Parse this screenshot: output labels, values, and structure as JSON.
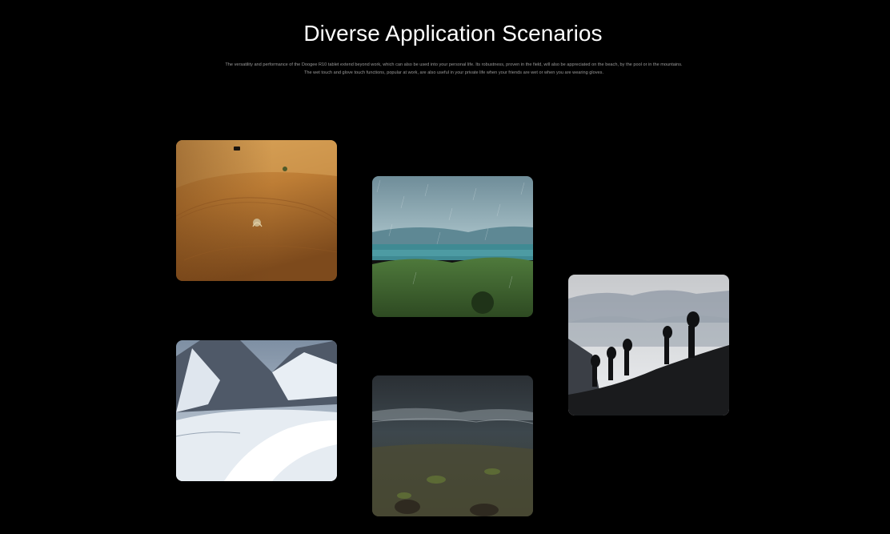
{
  "section": {
    "title": "Diverse Application Scenarios",
    "description": "The versatility and performance of the Doogee R10 tablet extend beyond work, which can also be used into your personal life. Its robustness, proven in the field, will also be appreciated on the beach, by the pool or in the mountains. The wet touch and glove touch functions, popular at work, are also useful in your private life when your friends are wet or when you are wearing gloves."
  },
  "gallery": {
    "scenes": [
      "desert",
      "rain",
      "hikers",
      "snow",
      "shore"
    ]
  },
  "colors": {
    "background": "#000000",
    "title": "#ffffff",
    "description": "#9a9a9a"
  }
}
